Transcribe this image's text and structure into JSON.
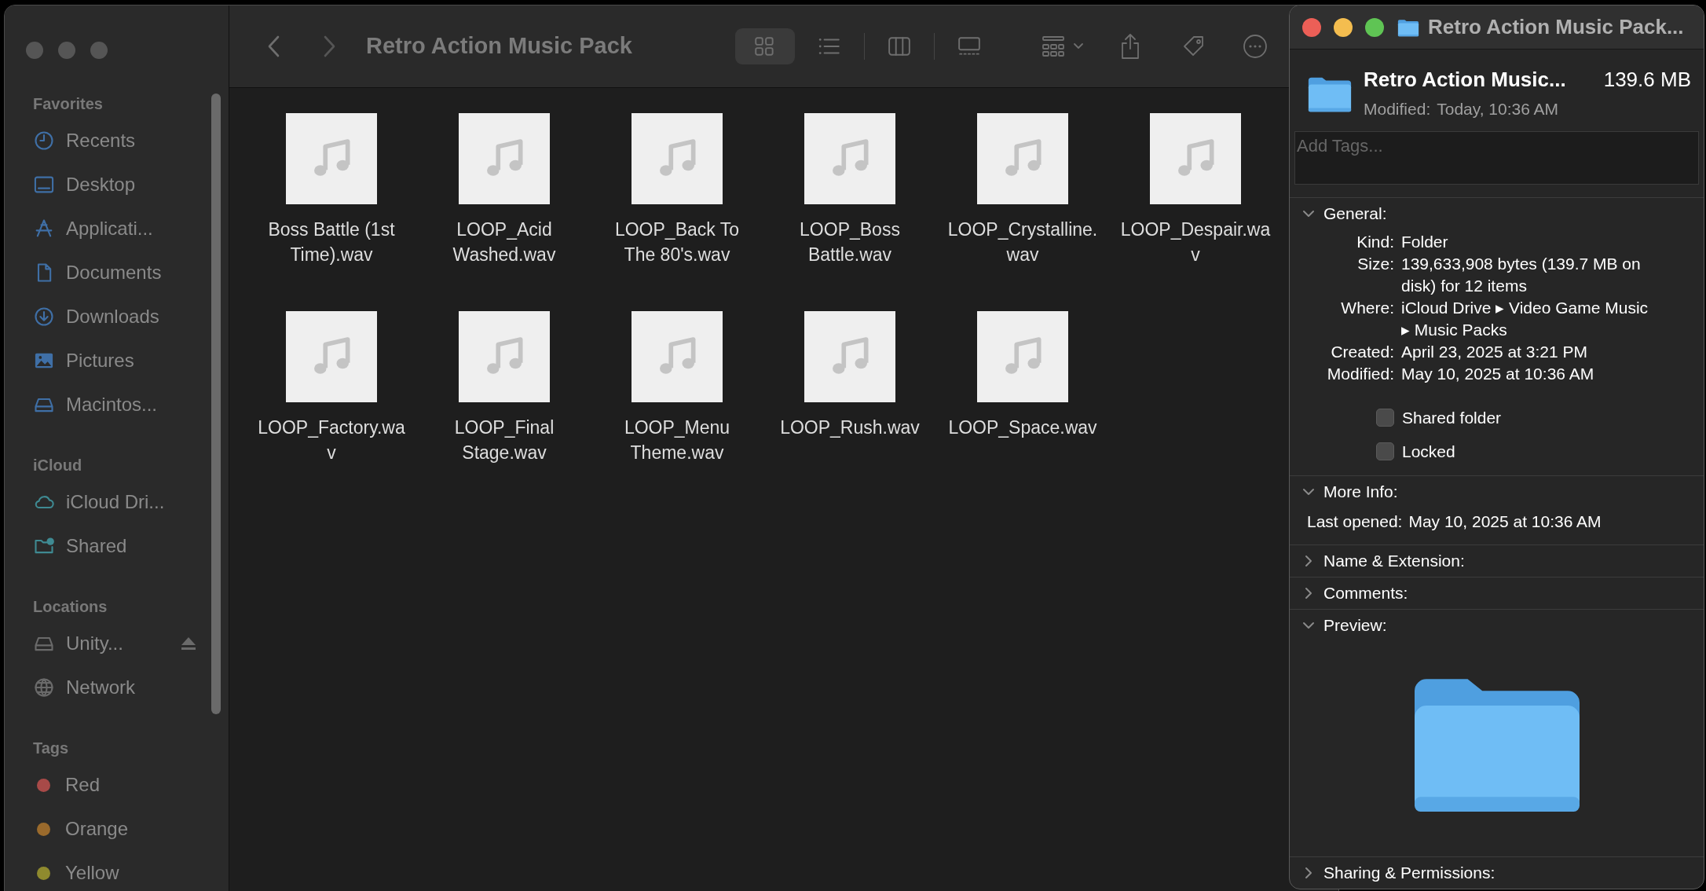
{
  "finder": {
    "title": "Retro Action Music Pack",
    "view_modes": [
      {
        "kind": "icons",
        "selected": true
      },
      {
        "kind": "list",
        "selected": false
      },
      {
        "kind": "columns",
        "selected": false
      },
      {
        "kind": "gallery",
        "selected": false
      }
    ],
    "sidebar": [
      {
        "heading": "Favorites",
        "items": [
          {
            "label": "Recents",
            "kind": "clock"
          },
          {
            "label": "Desktop",
            "kind": "desktop"
          },
          {
            "label": "Applicati...",
            "kind": "apps"
          },
          {
            "label": "Documents",
            "kind": "document"
          },
          {
            "label": "Downloads",
            "kind": "download"
          },
          {
            "label": "Pictures",
            "kind": "picture"
          },
          {
            "label": "Macintos...",
            "kind": "drive"
          }
        ]
      },
      {
        "heading": "iCloud",
        "items": [
          {
            "label": "iCloud Dri...",
            "kind": "cloud"
          },
          {
            "label": "Shared",
            "kind": "shared"
          }
        ]
      },
      {
        "heading": "Locations",
        "items": [
          {
            "label": "Unity...",
            "kind": "drive",
            "eject": true
          },
          {
            "label": "Network",
            "kind": "globe",
            "eject": false
          }
        ]
      },
      {
        "heading": "Tags",
        "items": [
          {
            "label": "Red",
            "color": "#a84a48"
          },
          {
            "label": "Orange",
            "color": "#9a6a2c"
          },
          {
            "label": "Yellow",
            "color": "#8f8a2e"
          }
        ]
      }
    ],
    "files": [
      {
        "name_lines": [
          "Boss Battle (1st",
          "Time).wav"
        ]
      },
      {
        "name_lines": [
          "LOOP_Acid",
          "Washed.wav"
        ]
      },
      {
        "name_lines": [
          "LOOP_Back To",
          "The 80's.wav"
        ]
      },
      {
        "name_lines": [
          "LOOP_Boss",
          "Battle.wav"
        ]
      },
      {
        "name_lines": [
          "LOOP_Crystalline.",
          "wav"
        ]
      },
      {
        "name_lines": [
          "LOOP_Despair.wa",
          "v"
        ]
      },
      {
        "name_lines": [
          "LOOP_Factory.wa",
          "v"
        ]
      },
      {
        "name_lines": [
          "LOOP_Final",
          "Stage.wav"
        ]
      },
      {
        "name_lines": [
          "LOOP_Menu",
          "Theme.wav"
        ]
      },
      {
        "name_lines": [
          "LOOP_Rush.wav"
        ]
      },
      {
        "name_lines": [
          "LOOP_Space.wav"
        ]
      }
    ]
  },
  "info_window": {
    "title": "Retro Action Music Pack...",
    "name": "Retro Action Music...",
    "size": "139.6 MB",
    "modified_label": "Modified:",
    "modified_value": "Today, 10:36 AM",
    "tags": {
      "placeholder": "Add Tags..."
    },
    "sections": [
      {
        "title": "General:",
        "expanded": true,
        "kind": "general",
        "fields": [
          {
            "label": "Kind:",
            "value_lines": [
              "Folder"
            ]
          },
          {
            "label": "Size:",
            "value_lines": [
              "139,633,908 bytes (139.7 MB on",
              "disk) for 12 items"
            ]
          },
          {
            "label": "Where:",
            "value_lines": [
              "iCloud Drive ▸ Video Game Music",
              "▸ Music Packs"
            ]
          },
          {
            "label": "Created:",
            "value_lines": [
              "April 23, 2025 at 3:21 PM"
            ]
          },
          {
            "label": "Modified:",
            "value_lines": [
              "May 10, 2025 at 10:36 AM"
            ]
          }
        ],
        "checkboxes": [
          {
            "label": "Shared folder",
            "checked": false
          },
          {
            "label": "Locked",
            "checked": false
          }
        ]
      },
      {
        "title": "More Info:",
        "expanded": true,
        "kind": "more",
        "last_opened_label": "Last opened:",
        "last_opened_value": "May 10, 2025 at 10:36 AM"
      },
      {
        "title": "Name & Extension:",
        "expanded": false,
        "kind": "plain"
      },
      {
        "title": "Comments:",
        "expanded": false,
        "kind": "plain"
      },
      {
        "title": "Preview:",
        "expanded": true,
        "kind": "preview"
      },
      {
        "title": "Sharing & Permissions:",
        "expanded": false,
        "kind": "plain"
      }
    ]
  }
}
